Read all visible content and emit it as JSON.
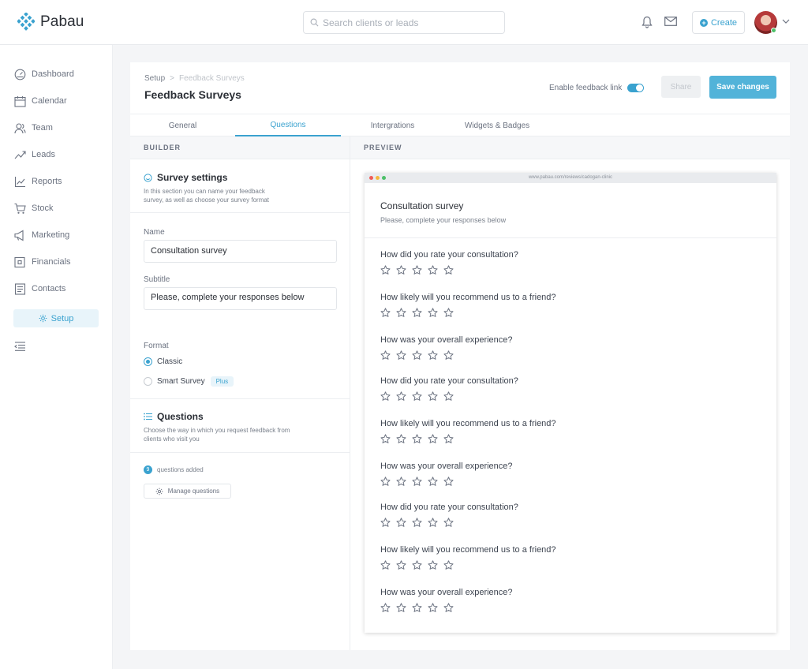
{
  "app": {
    "name": "Pabau"
  },
  "header": {
    "search_placeholder": "Search clients or leads",
    "create_label": "Create"
  },
  "sidebar": {
    "items": [
      {
        "label": "Dashboard",
        "icon": "dashboard-icon"
      },
      {
        "label": "Calendar",
        "icon": "calendar-icon"
      },
      {
        "label": "Team",
        "icon": "team-icon"
      },
      {
        "label": "Leads",
        "icon": "leads-icon"
      },
      {
        "label": "Reports",
        "icon": "reports-icon"
      },
      {
        "label": "Stock",
        "icon": "cart-icon"
      },
      {
        "label": "Marketing",
        "icon": "megaphone-icon"
      },
      {
        "label": "Financials",
        "icon": "wallet-icon"
      },
      {
        "label": "Contacts",
        "icon": "contacts-icon"
      },
      {
        "label": "Setup",
        "icon": "gear-icon",
        "active": true
      }
    ]
  },
  "page": {
    "breadcrumb": [
      "Setup",
      "Feedback Surveys"
    ],
    "title": "Feedback Surveys",
    "toggle_label": "Enable feedback link",
    "toggle_on": true,
    "share_label": "Share",
    "save_label": "Save changes",
    "tabs": [
      {
        "label": "General",
        "active": false
      },
      {
        "label": "Questions",
        "active": true
      },
      {
        "label": "Intergrations",
        "active": false
      },
      {
        "label": "Widgets & Badges",
        "active": false
      }
    ]
  },
  "builder": {
    "heading": "BUILDER",
    "survey_settings": {
      "title": "Survey settings",
      "description": "In this section you can name your feedback survey, as well as choose your survey format"
    },
    "name_label": "Name",
    "name_value": "Consultation survey",
    "subtitle_label": "Subtitle",
    "subtitle_value": "Please, complete your responses below",
    "format_label": "Format",
    "formats": [
      {
        "label": "Classic",
        "selected": true
      },
      {
        "label": "Smart Survey",
        "selected": false,
        "badge": "Plus"
      }
    ],
    "questions": {
      "title": "Questions",
      "description": "Choose the way in which you request feedback from clients who visit you",
      "count": "9",
      "count_label": "questions added",
      "manage_label": "Manage questions"
    }
  },
  "preview": {
    "heading": "PREVIEW",
    "url": "www.pabau.com/reviews/cadogan-clinic",
    "survey_title": "Consultation survey",
    "survey_subtitle": "Please, complete your responses below",
    "questions": [
      "How did you rate your consultation?",
      "How likely will you recommend us to a friend?",
      "How was your overall experience?",
      "How did you rate your consultation?",
      "How likely will you recommend us to a friend?",
      "How was your overall experience?",
      "How did you rate your consultation?",
      "How likely will you recommend us to a friend?",
      "How was your overall experience?"
    ],
    "stars_per_question": 5
  },
  "colors": {
    "accent": "#3aa2cf",
    "save_button": "#52b3d9",
    "text": "#3d4450",
    "background": "#f4f5f7"
  }
}
